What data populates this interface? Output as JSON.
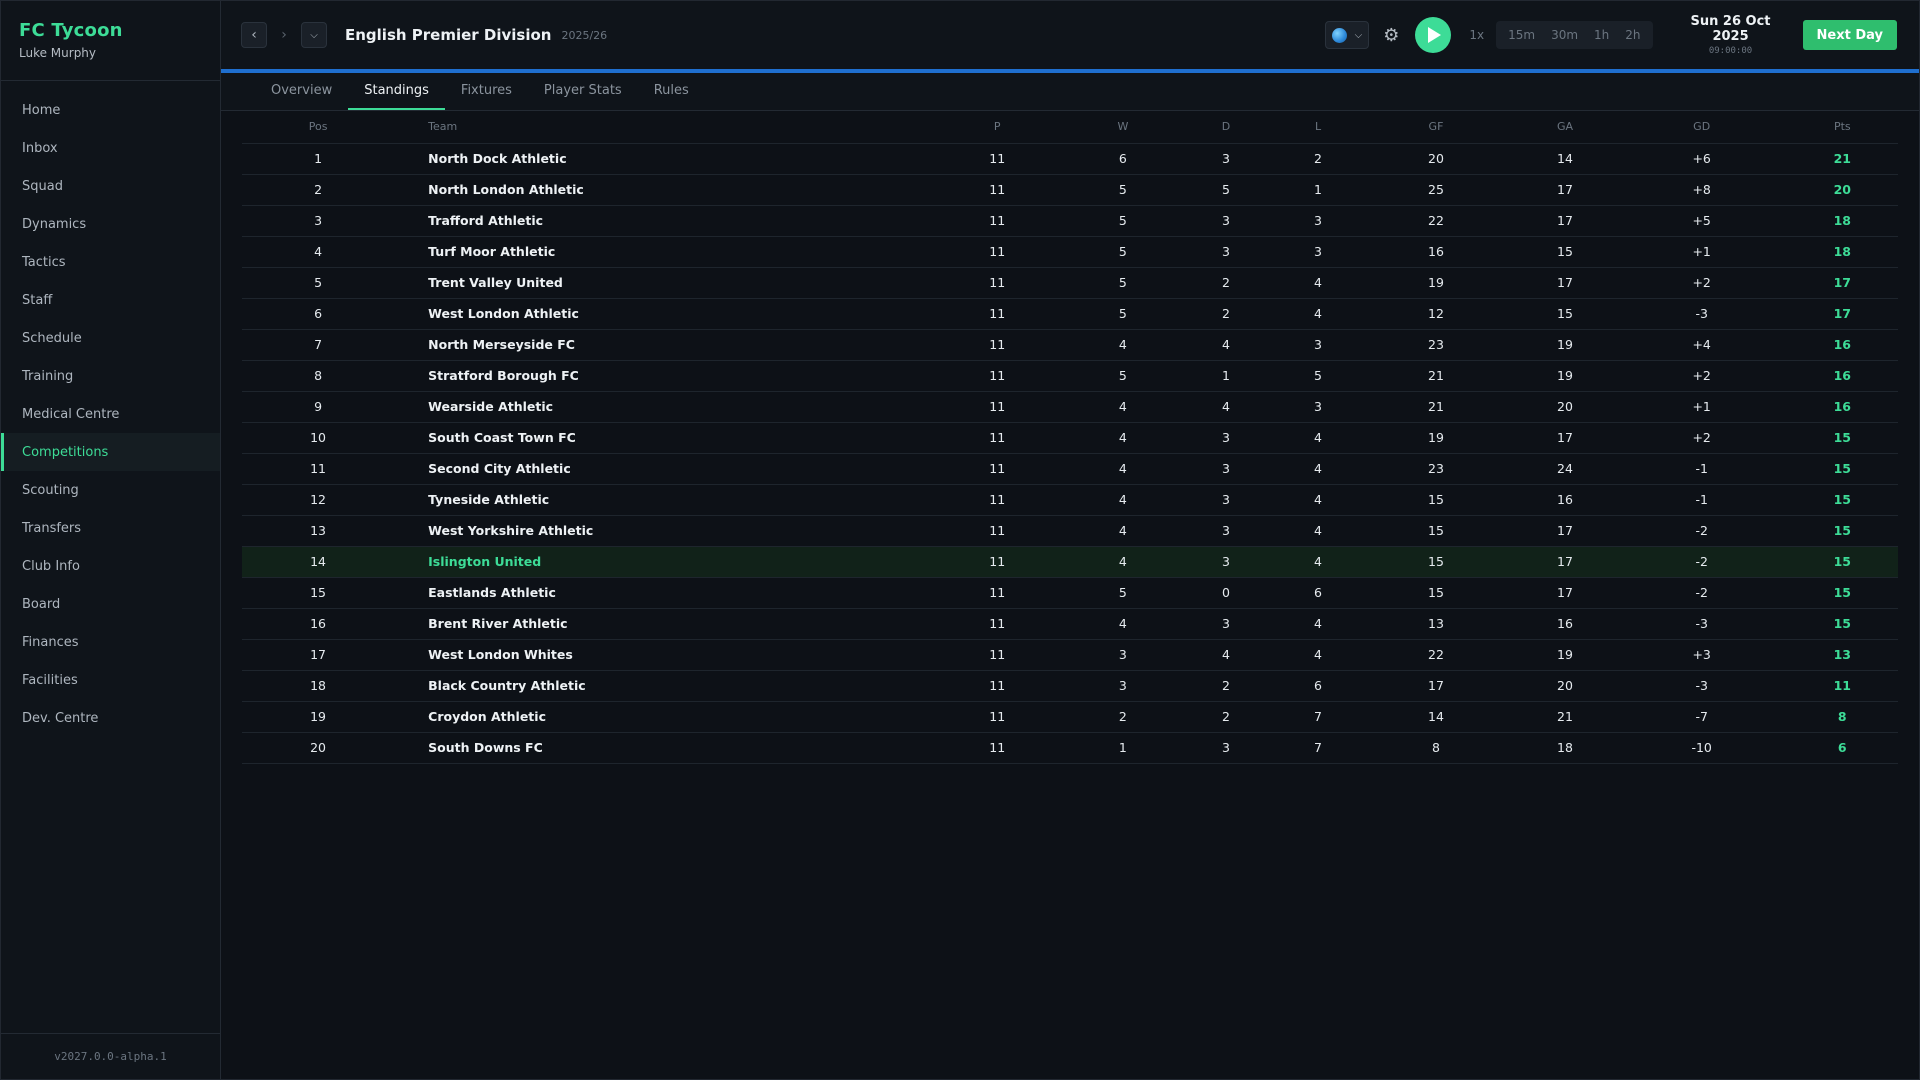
{
  "app": {
    "title": "FC Tycoon",
    "manager": "Luke Murphy",
    "version": "v2027.0.0-alpha.1"
  },
  "sidebar": {
    "items": [
      {
        "label": "Home",
        "icon": "home"
      },
      {
        "label": "Inbox",
        "icon": "inbox"
      },
      {
        "label": "Squad",
        "icon": "squad"
      },
      {
        "label": "Dynamics",
        "icon": "dynamics"
      },
      {
        "label": "Tactics",
        "icon": "tactics"
      },
      {
        "label": "Staff",
        "icon": "staff"
      },
      {
        "label": "Schedule",
        "icon": "schedule"
      },
      {
        "label": "Training",
        "icon": "training"
      },
      {
        "label": "Medical Centre",
        "icon": "medical"
      },
      {
        "label": "Competitions",
        "icon": "competitions",
        "active": true
      },
      {
        "label": "Scouting",
        "icon": "scouting"
      },
      {
        "label": "Transfers",
        "icon": "transfers"
      },
      {
        "label": "Club Info",
        "icon": "club-info"
      },
      {
        "label": "Board",
        "icon": "board"
      },
      {
        "label": "Finances",
        "icon": "finances"
      },
      {
        "label": "Facilities",
        "icon": "facilities"
      },
      {
        "label": "Dev. Centre",
        "icon": "dev-centre"
      }
    ]
  },
  "header": {
    "competition": "English Premier Division",
    "season": "2025/26",
    "speed_current": "1x",
    "speed_options": [
      "15m",
      "30m",
      "1h",
      "2h"
    ],
    "date": "Sun 26 Oct 2025",
    "time": "09:00:00",
    "next_day_label": "Next Day",
    "icons": {
      "back": "chevron-left-icon",
      "forward": "chevron-right-icon",
      "menu": "chevron-down-icon",
      "globe": "globe-icon",
      "settings": "gear-icon",
      "play": "play-icon"
    }
  },
  "tabs": [
    {
      "label": "Overview"
    },
    {
      "label": "Standings",
      "active": true
    },
    {
      "label": "Fixtures"
    },
    {
      "label": "Player Stats"
    },
    {
      "label": "Rules"
    }
  ],
  "standings": {
    "columns": [
      "Pos",
      "Team",
      "P",
      "W",
      "D",
      "L",
      "GF",
      "GA",
      "GD",
      "Pts"
    ],
    "highlight_team": "Islington United",
    "rows": [
      {
        "pos": "1",
        "team": "North Dock Athletic",
        "p": "11",
        "w": "6",
        "d": "3",
        "l": "2",
        "gf": "20",
        "ga": "14",
        "gd": "+6",
        "pts": "21"
      },
      {
        "pos": "2",
        "team": "North London Athletic",
        "p": "11",
        "w": "5",
        "d": "5",
        "l": "1",
        "gf": "25",
        "ga": "17",
        "gd": "+8",
        "pts": "20"
      },
      {
        "pos": "3",
        "team": "Trafford Athletic",
        "p": "11",
        "w": "5",
        "d": "3",
        "l": "3",
        "gf": "22",
        "ga": "17",
        "gd": "+5",
        "pts": "18"
      },
      {
        "pos": "4",
        "team": "Turf Moor Athletic",
        "p": "11",
        "w": "5",
        "d": "3",
        "l": "3",
        "gf": "16",
        "ga": "15",
        "gd": "+1",
        "pts": "18"
      },
      {
        "pos": "5",
        "team": "Trent Valley United",
        "p": "11",
        "w": "5",
        "d": "2",
        "l": "4",
        "gf": "19",
        "ga": "17",
        "gd": "+2",
        "pts": "17"
      },
      {
        "pos": "6",
        "team": "West London Athletic",
        "p": "11",
        "w": "5",
        "d": "2",
        "l": "4",
        "gf": "12",
        "ga": "15",
        "gd": "-3",
        "pts": "17"
      },
      {
        "pos": "7",
        "team": "North Merseyside FC",
        "p": "11",
        "w": "4",
        "d": "4",
        "l": "3",
        "gf": "23",
        "ga": "19",
        "gd": "+4",
        "pts": "16"
      },
      {
        "pos": "8",
        "team": "Stratford Borough FC",
        "p": "11",
        "w": "5",
        "d": "1",
        "l": "5",
        "gf": "21",
        "ga": "19",
        "gd": "+2",
        "pts": "16"
      },
      {
        "pos": "9",
        "team": "Wearside Athletic",
        "p": "11",
        "w": "4",
        "d": "4",
        "l": "3",
        "gf": "21",
        "ga": "20",
        "gd": "+1",
        "pts": "16"
      },
      {
        "pos": "10",
        "team": "South Coast Town FC",
        "p": "11",
        "w": "4",
        "d": "3",
        "l": "4",
        "gf": "19",
        "ga": "17",
        "gd": "+2",
        "pts": "15"
      },
      {
        "pos": "11",
        "team": "Second City Athletic",
        "p": "11",
        "w": "4",
        "d": "3",
        "l": "4",
        "gf": "23",
        "ga": "24",
        "gd": "-1",
        "pts": "15"
      },
      {
        "pos": "12",
        "team": "Tyneside Athletic",
        "p": "11",
        "w": "4",
        "d": "3",
        "l": "4",
        "gf": "15",
        "ga": "16",
        "gd": "-1",
        "pts": "15"
      },
      {
        "pos": "13",
        "team": "West Yorkshire Athletic",
        "p": "11",
        "w": "4",
        "d": "3",
        "l": "4",
        "gf": "15",
        "ga": "17",
        "gd": "-2",
        "pts": "15"
      },
      {
        "pos": "14",
        "team": "Islington United",
        "p": "11",
        "w": "4",
        "d": "3",
        "l": "4",
        "gf": "15",
        "ga": "17",
        "gd": "-2",
        "pts": "15"
      },
      {
        "pos": "15",
        "team": "Eastlands Athletic",
        "p": "11",
        "w": "5",
        "d": "0",
        "l": "6",
        "gf": "15",
        "ga": "17",
        "gd": "-2",
        "pts": "15"
      },
      {
        "pos": "16",
        "team": "Brent River Athletic",
        "p": "11",
        "w": "4",
        "d": "3",
        "l": "4",
        "gf": "13",
        "ga": "16",
        "gd": "-3",
        "pts": "15"
      },
      {
        "pos": "17",
        "team": "West London Whites",
        "p": "11",
        "w": "3",
        "d": "4",
        "l": "4",
        "gf": "22",
        "ga": "19",
        "gd": "+3",
        "pts": "13"
      },
      {
        "pos": "18",
        "team": "Black Country Athletic",
        "p": "11",
        "w": "3",
        "d": "2",
        "l": "6",
        "gf": "17",
        "ga": "20",
        "gd": "-3",
        "pts": "11"
      },
      {
        "pos": "19",
        "team": "Croydon Athletic",
        "p": "11",
        "w": "2",
        "d": "2",
        "l": "7",
        "gf": "14",
        "ga": "21",
        "gd": "-7",
        "pts": "8"
      },
      {
        "pos": "20",
        "team": "South Downs FC",
        "p": "11",
        "w": "1",
        "d": "3",
        "l": "7",
        "gf": "8",
        "ga": "18",
        "gd": "-10",
        "pts": "6"
      }
    ]
  },
  "colors": {
    "accent": "#3ddc97",
    "header_rule": "#1f6fcf",
    "next_day": "#2fbe6e",
    "highlight_row": "#112219"
  }
}
